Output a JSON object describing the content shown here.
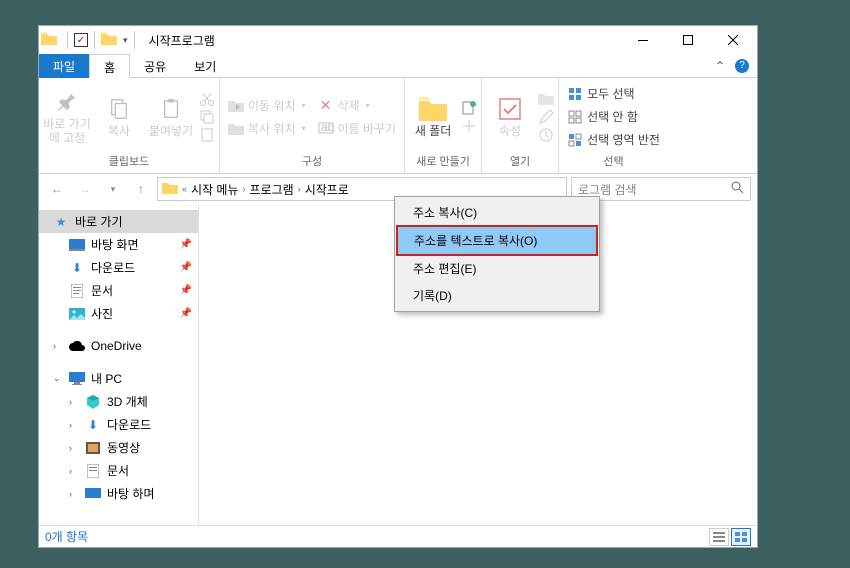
{
  "window": {
    "title": "시작프로그램"
  },
  "tabs": {
    "file": "파일",
    "home": "홈",
    "share": "공유",
    "view": "보기"
  },
  "ribbon": {
    "clipboard": {
      "label": "클립보드",
      "pin": "바로 가기에 고정",
      "copy": "복사",
      "paste": "붙여넣기"
    },
    "organize": {
      "label": "구성",
      "move_to": "이동 위치",
      "delete": "삭제",
      "copy_to": "복사 위치",
      "rename": "이름 바꾸기"
    },
    "new": {
      "label": "새로 만들기",
      "new_folder": "새 폴더"
    },
    "open": {
      "label": "열기",
      "properties": "속성"
    },
    "select": {
      "label": "선택",
      "select_all": "모두 선택",
      "select_none": "선택 안 함",
      "invert": "선택 영역 반전"
    }
  },
  "breadcrumb": {
    "items": [
      "시작 메뉴",
      "프로그램",
      "시작프로"
    ]
  },
  "search": {
    "placeholder": "로그램 검색"
  },
  "sidebar": {
    "quick_access": "바로 가기",
    "desktop": "바탕 화면",
    "downloads": "다운로드",
    "documents": "문서",
    "pictures": "사진",
    "onedrive": "OneDrive",
    "this_pc": "내 PC",
    "objects_3d": "3D 개체",
    "downloads2": "다운로드",
    "videos": "동영상",
    "documents2": "문서",
    "desktop2": "바탕 하며"
  },
  "context_menu": {
    "copy_address": "주소 복사(C)",
    "copy_as_text": "주소를 텍스트로 복사(O)",
    "edit_address": "주소 편집(E)",
    "history": "기록(D)"
  },
  "statusbar": {
    "count": "0개 항목"
  }
}
